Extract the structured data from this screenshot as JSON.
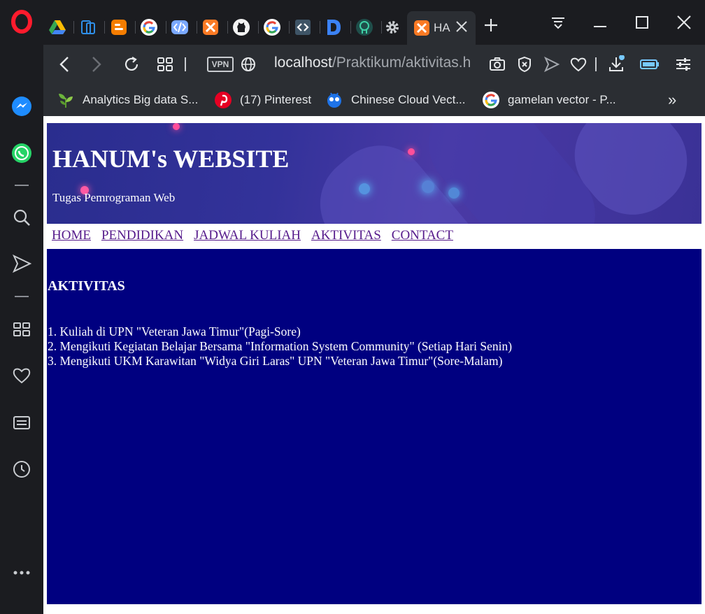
{
  "browser": {
    "active_tab_label": "HA",
    "tabs": [
      {
        "name": "google-drive"
      },
      {
        "name": "mobile-app"
      },
      {
        "name": "blogger"
      },
      {
        "name": "google"
      },
      {
        "name": "code-stream"
      },
      {
        "name": "xampp"
      },
      {
        "name": "github"
      },
      {
        "name": "google"
      },
      {
        "name": "codeigniter"
      },
      {
        "name": "d-app"
      },
      {
        "name": "brain-app"
      },
      {
        "name": "settings"
      }
    ],
    "vpn_label": "VPN",
    "url_host": "localhost",
    "url_path": "/Praktikum/aktivitas.h",
    "bookmarks": [
      {
        "label": "Analytics Big data S...",
        "icon": "plant-icon"
      },
      {
        "label": "(17) Pinterest",
        "icon": "pinterest-icon"
      },
      {
        "label": "Chinese Cloud Vect...",
        "icon": "freepik-icon"
      },
      {
        "label": "gamelan vector - P...",
        "icon": "google-icon"
      }
    ],
    "bookmarks_more": "»"
  },
  "page": {
    "site_title": "HANUM's WEBSITE",
    "site_subtitle": "Tugas Pemrograman Web",
    "nav": [
      "HOME",
      "PENDIDIKAN",
      "JADWAL KULIAH",
      "AKTIVITAS",
      "CONTACT"
    ],
    "section_title": "AKTIVITAS",
    "items": [
      "1. Kuliah di UPN \"Veteran Jawa Timur\"(Pagi-Sore)",
      "2. Mengikuti Kegiatan Belajar Bersama \"Information System Community\" (Setiap Hari Senin)",
      "3. Mengikuti UKM Karawitan \"Widya Giri Laras\" UPN \"Veteran Jawa Timur\"(Sore-Malam)"
    ]
  },
  "colors": {
    "content_bg": "#000080",
    "link": "#551a8b",
    "browser_dark": "#1b1c20",
    "toolbar": "#2b2e33"
  }
}
